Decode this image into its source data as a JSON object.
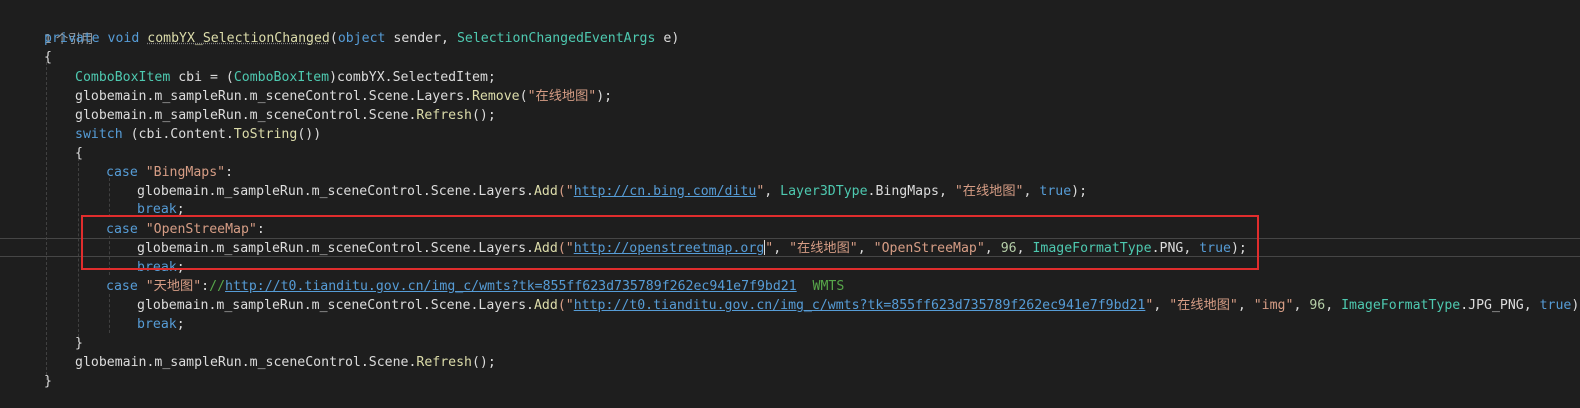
{
  "codelens": "1 个引用",
  "lines": {
    "l1": {
      "kw1": "private",
      "kw2": "void",
      "method": "combYX_SelectionChanged",
      "open": "(",
      "kw3": "object",
      "sender": " sender, ",
      "type": "SelectionChangedEventArgs",
      "rest": " e)"
    },
    "l2": "{",
    "l3": {
      "type1": "ComboBoxItem",
      "mid": " cbi = (",
      "type2": "ComboBoxItem",
      "rest": ")combYX.SelectedItem;"
    },
    "l4": {
      "pre": "globemain.m_sampleRun.m_sceneControl.Scene.Layers.",
      "method": "Remove",
      "open": "(",
      "str": "\"在线地图\"",
      "rest": ");"
    },
    "l5": {
      "pre": "globemain.m_sampleRun.m_sceneControl.Scene.",
      "method": "Refresh",
      "rest": "();"
    },
    "l6": {
      "kw": "switch",
      "pre": " (cbi.Content.",
      "method": "ToString",
      "rest": "())"
    },
    "l7": "{",
    "l8": {
      "kw": "case",
      "str": "\"BingMaps\"",
      "rest": ":"
    },
    "l9": {
      "pre": "globemain.m_sampleRun.m_sceneControl.Scene.Layers.",
      "method": "Add",
      "q1": "(\"",
      "link": "http://cn.bing.com/ditu",
      "q2": "\"",
      "comma1": ", ",
      "type": "Layer3DType",
      "mid": ".BingMaps, ",
      "str": "\"在线地图\"",
      "comma2": ", ",
      "kw": "true",
      "rest": ");"
    },
    "l10": {
      "kw": "break",
      "rest": ";"
    },
    "l11": {
      "kw": "case",
      "str": "\"OpenStreeMap\"",
      "rest": ":"
    },
    "l12": {
      "pre": "globemain.m_sampleRun.m_sceneControl.Scene.Layers.",
      "method": "Add",
      "q1": "(\"",
      "link": "http://openstreetmap.org",
      "q2": "\"",
      "c1": ", ",
      "s1": "\"在线地图\"",
      "c2": ", ",
      "s2": "\"OpenStreeMap\"",
      "c3": ", ",
      "num": "96",
      "c4": ", ",
      "type": "ImageFormatType",
      "mid": ".PNG, ",
      "kw": "true",
      "rest": ");"
    },
    "l13": {
      "kw": "break",
      "rest": ";"
    },
    "l14": {
      "kw": "case",
      "str": "\"天地图\"",
      "colon": ":",
      "cm1": "//",
      "link": "http://t0.tianditu.gov.cn/img_c/wmts?tk=855ff623d735789f262ec941e7f9bd21",
      "cm2": "  WMTS"
    },
    "l15": {
      "pre": "globemain.m_sampleRun.m_sceneControl.Scene.Layers.",
      "method": "Add",
      "q1": "(\"",
      "link": "http://t0.tianditu.gov.cn/img_c/wmts?tk=855ff623d735789f262ec941e7f9bd21",
      "q2": "\"",
      "c1": ", ",
      "s1": "\"在线地图\"",
      "c2": ", ",
      "s2": "\"img\"",
      "c3": ", ",
      "num": "96",
      "c4": ", ",
      "type": "ImageFormatType",
      "mid": ".JPG_PNG, ",
      "kw": "true",
      "rest": ");"
    },
    "l16": {
      "kw": "break",
      "rest": ";"
    },
    "l17": "}",
    "l18": {
      "pre": "globemain.m_sampleRun.m_sceneControl.Scene.",
      "method": "Refresh",
      "rest": "();"
    },
    "l19": "}"
  },
  "colors": {
    "keyword": "#569cd6",
    "string": "#d69d85",
    "type": "#4ec9b0",
    "method": "#dcdcaa",
    "highlight_box": "#e12d2d"
  }
}
